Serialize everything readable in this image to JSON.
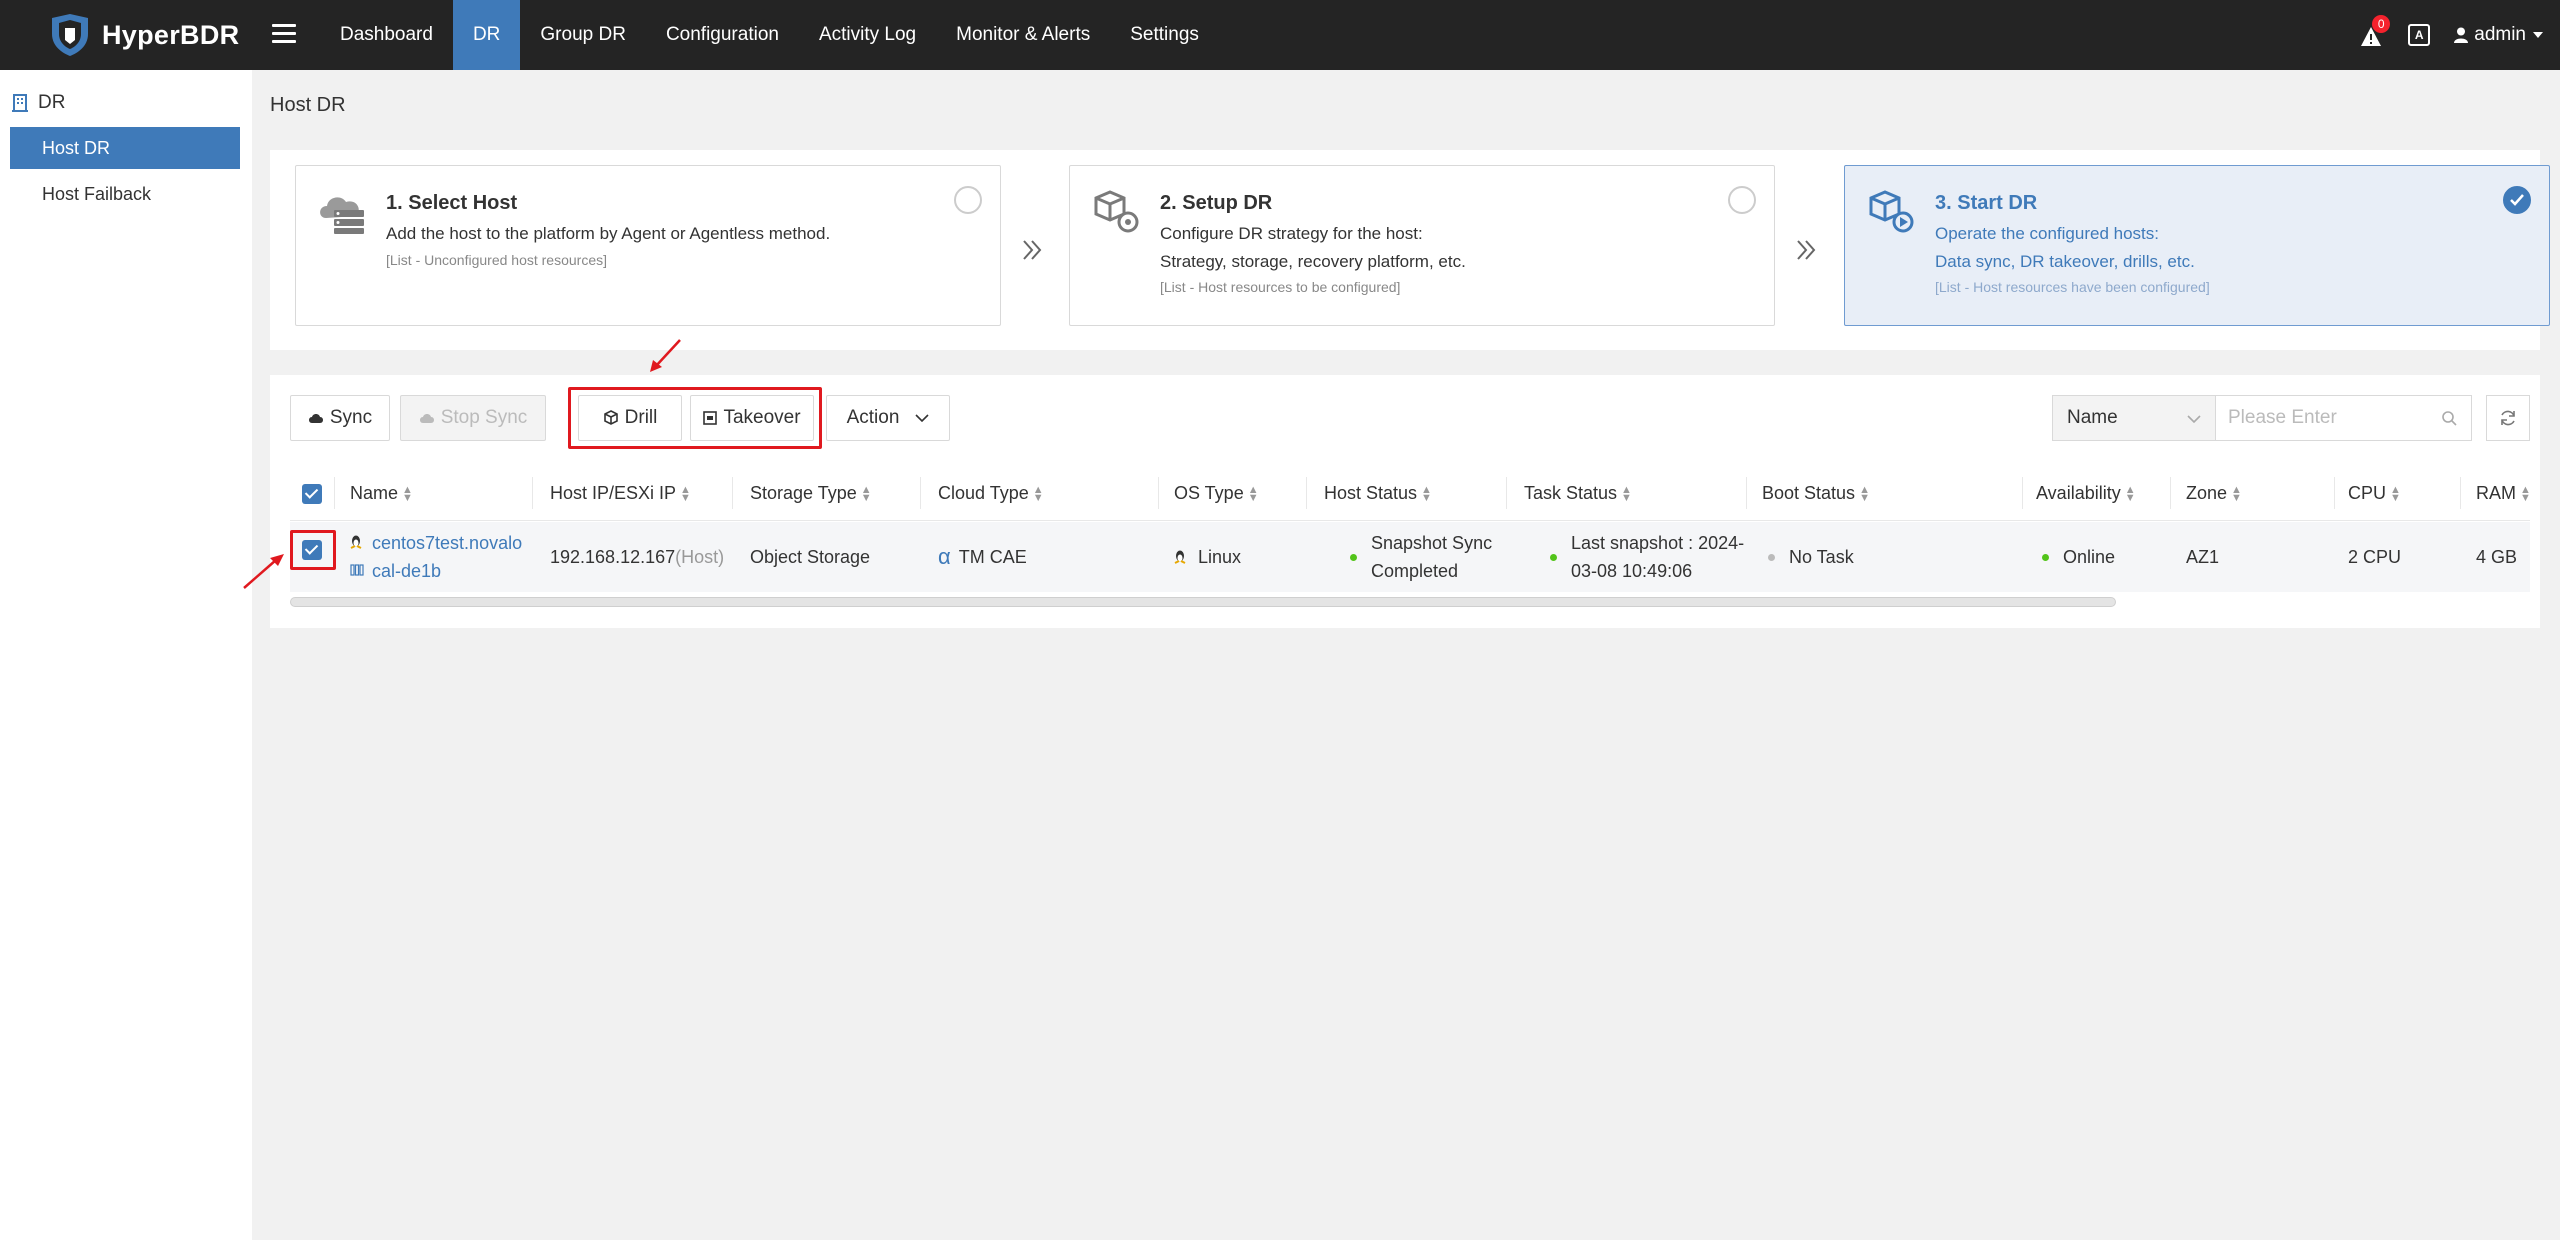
{
  "app": {
    "name": "HyperBDR"
  },
  "nav": {
    "items": [
      {
        "label": "Dashboard",
        "active": false
      },
      {
        "label": "DR",
        "active": true
      },
      {
        "label": "Group DR",
        "active": false
      },
      {
        "label": "Configuration",
        "active": false
      },
      {
        "label": "Activity Log",
        "active": false
      },
      {
        "label": "Monitor & Alerts",
        "active": false
      },
      {
        "label": "Settings",
        "active": false
      }
    ],
    "alert_count": "0",
    "lang_icon": "A",
    "user": "admin"
  },
  "sidebar": {
    "group": "DR",
    "items": [
      {
        "label": "Host DR",
        "active": true
      },
      {
        "label": "Host Failback",
        "active": false
      }
    ]
  },
  "page": {
    "title": "Host DR"
  },
  "steps": [
    {
      "title": "1. Select Host",
      "desc1": "Add the host to the platform by Agent or Agentless method.",
      "desc2": "",
      "note": "[List - Unconfigured host resources]",
      "done": false,
      "icon": "cloud-host-icon"
    },
    {
      "title": "2. Setup DR",
      "desc1": "Configure DR strategy for the host:",
      "desc2": "Strategy, storage, recovery platform, etc.",
      "note": "[List - Host resources to be configured]",
      "done": false,
      "icon": "setup-cube-icon"
    },
    {
      "title": "3. Start DR",
      "desc1": "Operate the configured hosts:",
      "desc2": "Data sync, DR takeover, drills, etc.",
      "note": "[List - Host resources have been configured]",
      "done": true,
      "icon": "start-cube-icon"
    }
  ],
  "toolbar": {
    "sync": "Sync",
    "stop_sync": "Stop Sync",
    "drill": "Drill",
    "takeover": "Takeover",
    "action": "Action",
    "search_field": "Name",
    "search_placeholder": "Please Enter"
  },
  "table": {
    "columns": [
      "Name",
      "Host IP/ESXi IP",
      "Storage Type",
      "Cloud Type",
      "OS Type",
      "Host Status",
      "Task Status",
      "Boot Status",
      "Availability",
      "Zone",
      "CPU",
      "RAM"
    ],
    "rows": [
      {
        "name_line1": "centos7test.novalo",
        "name_line2": "cal-de1b",
        "ip": "192.168.12.167",
        "ip_suffix": "(Host)",
        "storage": "Object Storage",
        "cloud": "TM CAE",
        "os": "Linux",
        "host_status_1": "Snapshot Sync",
        "host_status_2": "Completed",
        "task_status_1": "Last snapshot : 2024-",
        "task_status_2": "03-08 10:49:06",
        "boot_status": "No Task",
        "availability": "Online",
        "zone": "AZ1",
        "cpu": "2 CPU",
        "ram": "4 GB",
        "checked": true
      }
    ]
  },
  "colors": {
    "primary": "#3f7ab9",
    "topbar": "#242424",
    "success": "#52c41a",
    "highlight": "#e0191f"
  }
}
